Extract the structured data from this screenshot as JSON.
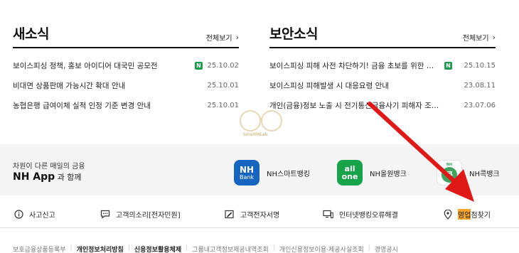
{
  "news": {
    "title": "새소식",
    "view_all": "전체보기",
    "items": [
      {
        "text": "보이스피싱 정책, 홍보 아이디어 대국민 공모전",
        "new": "N",
        "date": "25.10.02"
      },
      {
        "text": "비대면 상품판매 가능시간 확대 안내",
        "new": "",
        "date": "25.10.01"
      },
      {
        "text": "농협은행 급여이체 실적 인정 기준 변경 안내",
        "new": "",
        "date": "25.10.01"
      }
    ]
  },
  "security": {
    "title": "보안소식",
    "view_all": "전체보기",
    "items": [
      {
        "text": "보이스피싱 피해 사전 차단하기! 금융 초보를 위한 …",
        "new": "N",
        "date": "25.10.15"
      },
      {
        "text": "보이스피싱 피해발생 시 대응요령 안내",
        "new": "",
        "date": "23.08.11"
      },
      {
        "text": "개인(금융)정보 노출 시 전기통신금융사기 피해자 조…",
        "new": "",
        "date": "23.07.06"
      }
    ]
  },
  "watermark": "SmartMLab",
  "app_band": {
    "subtitle": "차원이 다른 매일의 금융",
    "title_bold": "NH App",
    "title_rest": " 과 함께",
    "apps": [
      {
        "label": "NH스마트뱅킹",
        "icon_line1": "NH",
        "icon_line2": "Bank",
        "color": "#1565c0"
      },
      {
        "label": "NH올원뱅크",
        "icon_line1": "all",
        "icon_line2": "one",
        "color": "#16a34a"
      },
      {
        "label": "NH콕뱅크",
        "icon_top": "NH",
        "icon_line1": "콕",
        "color": "#3da35d"
      }
    ]
  },
  "services": [
    {
      "label": "사고신고",
      "icon": "info-circle-icon"
    },
    {
      "label": "고객의소리[전자민원]",
      "icon": "chat-bubble-icon"
    },
    {
      "label": "고객전자서명",
      "icon": "signature-pen-icon"
    },
    {
      "label": "인터넷뱅킹오류해결",
      "icon": "computer-monitor-icon"
    }
  ],
  "branch_finder": {
    "highlight": "영업",
    "rest": "점찾기",
    "icon": "location-pin-icon"
  },
  "footer_links": [
    {
      "label": "보호금융상품등록부",
      "bold": false
    },
    {
      "label": "개인정보처리방침",
      "bold": true
    },
    {
      "label": "신용정보활용체제",
      "bold": true
    },
    {
      "label": "그룹내고객정보제공내역조회",
      "bold": false
    },
    {
      "label": "개인신용정보이용·제공사실조회",
      "bold": false
    },
    {
      "label": "경영공시",
      "bold": false
    }
  ],
  "colors": {
    "accent_red": "#e01818",
    "highlight_orange": "#f5a62a",
    "new_badge": "#1a9c4a"
  }
}
